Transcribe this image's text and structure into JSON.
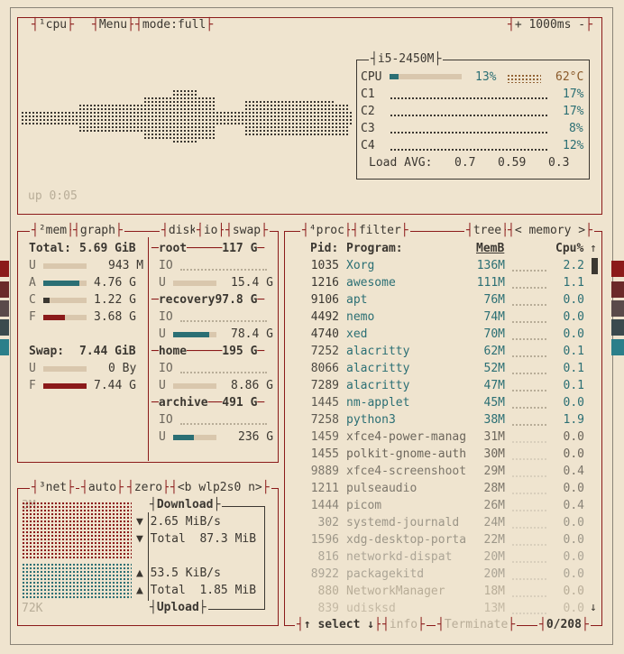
{
  "cpu_box": {
    "title_num": "¹",
    "title": "cpu",
    "menu": "Menu",
    "mode": "mode:full",
    "plus": "+",
    "interval": "1000ms",
    "minus": "-",
    "uptime": "up 0:05",
    "model": "i5-2450M",
    "total": {
      "label": "CPU",
      "pct": 13,
      "pct_label": "13%",
      "temp": "62°C"
    },
    "cores": [
      {
        "label": "C1",
        "pct_label": "17%"
      },
      {
        "label": "C2",
        "pct_label": "17%"
      },
      {
        "label": "C3",
        "pct_label": "8%"
      },
      {
        "label": "C4",
        "pct_label": "12%"
      }
    ],
    "load_label": "Load AVG:",
    "load": [
      "0.7",
      "0.59",
      "0.3"
    ]
  },
  "mem_box": {
    "title_num": "²",
    "title": "mem",
    "graph": "graph",
    "total_label": "Total:",
    "total_value": "5.69 GiB",
    "rows": [
      {
        "key": "U",
        "value": "943 M",
        "pct": 0
      },
      {
        "key": "A",
        "value": "4.76 G",
        "pct": 84
      },
      {
        "key": "C",
        "value": "1.22 G",
        "pct": 14
      },
      {
        "key": "F",
        "value": "3.68 G",
        "pct": 50
      }
    ],
    "swap_label": "Swap:",
    "swap_value": "7.44 GiB",
    "swap_rows": [
      {
        "key": "U",
        "value": "0 By",
        "pct": 0
      },
      {
        "key": "F",
        "value": "7.44 G",
        "pct": 100
      }
    ]
  },
  "disk_box": {
    "title": "disk",
    "io": "io",
    "swap": "swap",
    "disks": [
      {
        "name": "root",
        "size": "117 G",
        "io": "IO",
        "used_key": "U",
        "used_value": "15.4 G",
        "pct": 14
      },
      {
        "name": "recovery",
        "size": "97.8 G",
        "io": "IO",
        "used_key": "U",
        "used_value": "78.4 G",
        "pct": 82
      },
      {
        "name": "home",
        "size": "195 G",
        "io": "IO",
        "used_key": "U",
        "used_value": "8.86 G",
        "pct": 5
      },
      {
        "name": "archive",
        "size": "491 G",
        "io": "IO",
        "used_key": "U",
        "used_value": "236 G",
        "pct": 48
      }
    ]
  },
  "net_box": {
    "title_num": "³",
    "title": "net",
    "auto": "auto",
    "zero": "zero",
    "iface_prev": "<b",
    "iface": "wlp2s0",
    "iface_next": "n>",
    "scale_top": "3M",
    "scale_bottom": "72K",
    "download_label": "Download",
    "download_rate": "2.65 MiB/s",
    "download_total_label": "Total",
    "download_total": "87.3 MiB",
    "upload_rate": "53.5 KiB/s",
    "upload_total_label": "Total",
    "upload_total": "1.85 MiB",
    "upload_label": "Upload",
    "arrow_down": "▼",
    "arrow_up": "▲"
  },
  "proc_box": {
    "title_num": "⁴",
    "title": "proc",
    "filter": "filter",
    "tree": "tree",
    "sort_prev": "<",
    "sort": "memory",
    "sort_next": ">",
    "columns": {
      "pid": "Pid:",
      "program": "Program:",
      "mem": "MemB",
      "cpu": "Cpu%"
    },
    "scroll_up": "↑",
    "scroll_down": "↓",
    "footer_select": "↑ select ↓",
    "footer_info": "info",
    "footer_terminate": "Terminate",
    "footer_count": "0/208",
    "rows": [
      {
        "pid": "1035",
        "program": "Xorg",
        "mem": "136M",
        "cpu": "2.2"
      },
      {
        "pid": "1216",
        "program": "awesome",
        "mem": "111M",
        "cpu": "1.1"
      },
      {
        "pid": "9106",
        "program": "apt",
        "mem": "76M",
        "cpu": "0.0"
      },
      {
        "pid": "4492",
        "program": "nemo",
        "mem": "74M",
        "cpu": "0.0"
      },
      {
        "pid": "4740",
        "program": "xed",
        "mem": "70M",
        "cpu": "0.0"
      },
      {
        "pid": "7252",
        "program": "alacritty",
        "mem": "62M",
        "cpu": "0.1"
      },
      {
        "pid": "8066",
        "program": "alacritty",
        "mem": "52M",
        "cpu": "0.1"
      },
      {
        "pid": "7289",
        "program": "alacritty",
        "mem": "47M",
        "cpu": "0.1"
      },
      {
        "pid": "1445",
        "program": "nm-applet",
        "mem": "45M",
        "cpu": "0.0"
      },
      {
        "pid": "7258",
        "program": "python3",
        "mem": "38M",
        "cpu": "1.9"
      },
      {
        "pid": "1459",
        "program": "xfce4-power-manag",
        "mem": "31M",
        "cpu": "0.0"
      },
      {
        "pid": "1455",
        "program": "polkit-gnome-auth",
        "mem": "30M",
        "cpu": "0.0"
      },
      {
        "pid": "9889",
        "program": "xfce4-screenshoot",
        "mem": "29M",
        "cpu": "0.4"
      },
      {
        "pid": "1211",
        "program": "pulseaudio",
        "mem": "28M",
        "cpu": "0.0"
      },
      {
        "pid": "1444",
        "program": "picom",
        "mem": "26M",
        "cpu": "0.4"
      },
      {
        "pid": "302",
        "program": "systemd-journald",
        "mem": "24M",
        "cpu": "0.0"
      },
      {
        "pid": "1596",
        "program": "xdg-desktop-porta",
        "mem": "22M",
        "cpu": "0.0"
      },
      {
        "pid": "816",
        "program": "networkd-dispat",
        "mem": "20M",
        "cpu": "0.0"
      },
      {
        "pid": "8922",
        "program": "packagekitd",
        "mem": "20M",
        "cpu": "0.0"
      },
      {
        "pid": "880",
        "program": "NetworkManager",
        "mem": "18M",
        "cpu": "0.0"
      },
      {
        "pid": "839",
        "program": "udisksd",
        "mem": "13M",
        "cpu": "0.0"
      }
    ]
  },
  "colors": {
    "background": "#efe4cf",
    "border": "#8b1a1a",
    "text": "#3b3731",
    "teal": "#2b6f74",
    "bar_track": "#d9c7ad"
  }
}
